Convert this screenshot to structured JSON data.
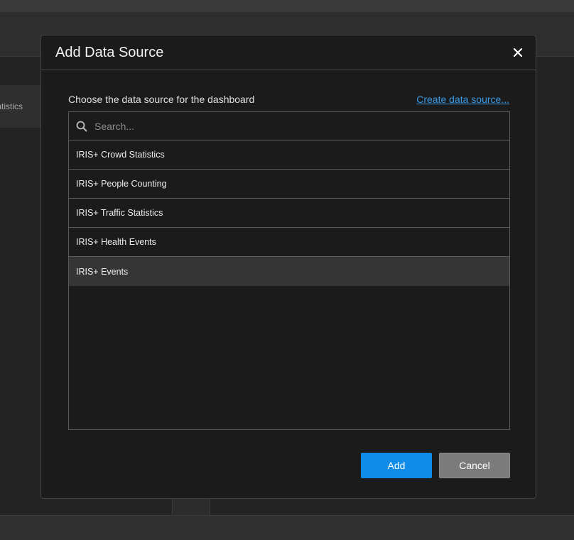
{
  "background": {
    "side_item_label": "Statistics"
  },
  "dialog": {
    "title": "Add Data Source",
    "close_icon": "close-icon",
    "prompt": "Choose the data source for the dashboard",
    "create_link": "Create data source...",
    "search": {
      "placeholder": "Search...",
      "value": ""
    },
    "items": [
      {
        "label": "IRIS+ Crowd Statistics",
        "selected": false
      },
      {
        "label": "IRIS+ People Counting",
        "selected": false
      },
      {
        "label": "IRIS+ Traffic Statistics",
        "selected": false
      },
      {
        "label": "IRIS+ Health Events",
        "selected": false
      },
      {
        "label": "IRIS+ Events",
        "selected": true
      }
    ],
    "buttons": {
      "add": "Add",
      "cancel": "Cancel"
    }
  },
  "colors": {
    "accent": "#0f8ce9",
    "link": "#3a9be8",
    "selected_row": "#353535"
  }
}
